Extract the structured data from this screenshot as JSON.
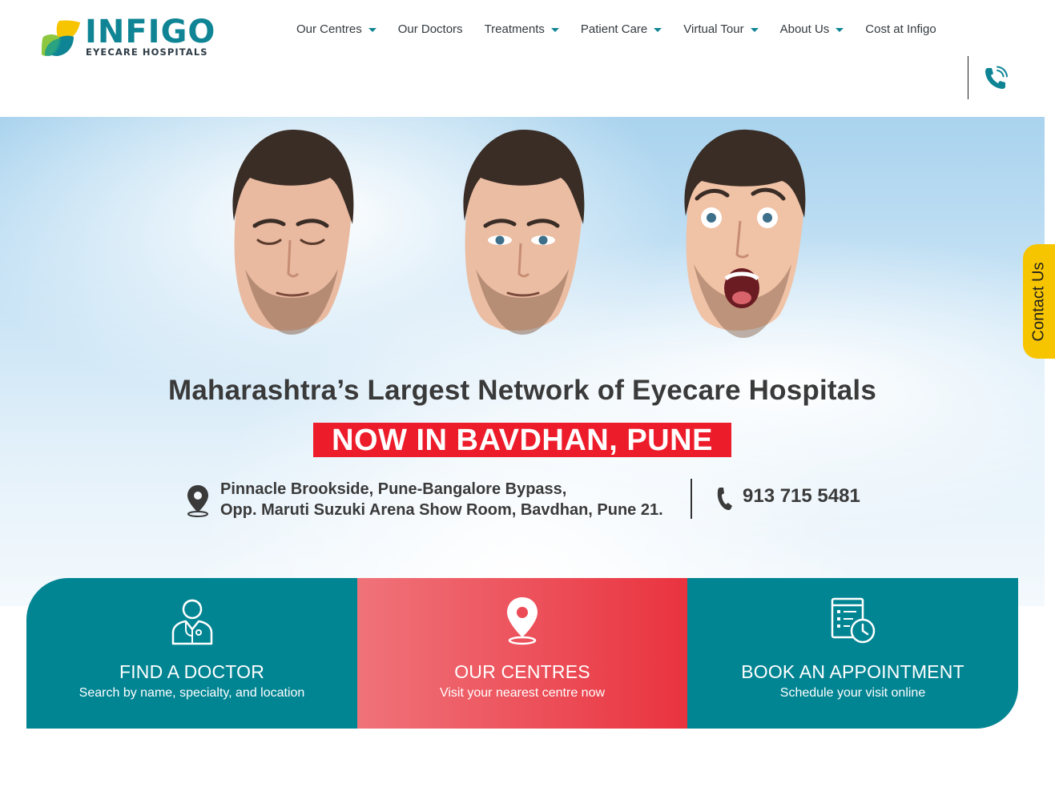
{
  "brand": {
    "name": "INFIGO",
    "tagline": "EYECARE HOSPITALS",
    "teal": "#0e8494",
    "green": "#8dc63f",
    "yellow": "#f7c500"
  },
  "nav": {
    "items": [
      {
        "label": "Our Centres",
        "has_caret": true
      },
      {
        "label": "Our Doctors",
        "has_caret": false
      },
      {
        "label": "Treatments",
        "has_caret": true
      },
      {
        "label": "Patient Care",
        "has_caret": true
      },
      {
        "label": "Virtual Tour",
        "has_caret": true
      },
      {
        "label": "About Us",
        "has_caret": true
      },
      {
        "label": "Cost at Infigo",
        "has_caret": false
      }
    ],
    "phone_icon": "phone-icon"
  },
  "hero": {
    "title": "Maharashtra’s Largest Network of Eyecare Hospitals",
    "banner": "NOW IN BAVDHAN, PUNE",
    "banner_color": "#ec1c2a",
    "address_line1": "Pinnacle Brookside, Pune-Bangalore Bypass,",
    "address_line2": "Opp. Maruti Suzuki Arena Show Room, Bavdhan, Pune 21.",
    "phone": "913 715 5481"
  },
  "contact_tab": {
    "label": "Contact Us"
  },
  "cards": [
    {
      "title": "FIND A DOCTOR",
      "subtitle": "Search by name, specialty, and location",
      "icon": "doctor-icon"
    },
    {
      "title": "OUR CENTRES",
      "subtitle": "Visit your nearest centre now",
      "icon": "location-pin-icon"
    },
    {
      "title": "BOOK AN APPOINTMENT",
      "subtitle": "Schedule your visit online",
      "icon": "calendar-clock-icon"
    }
  ]
}
